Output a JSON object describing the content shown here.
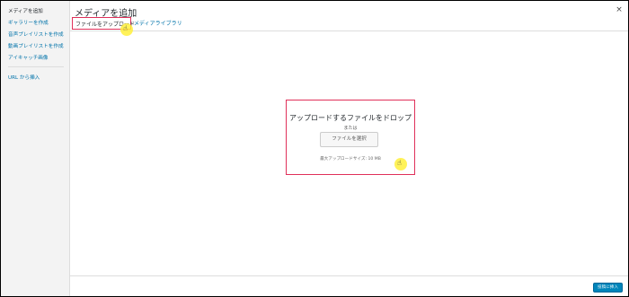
{
  "sidebar": {
    "items": [
      {
        "label": "メディアを追加"
      },
      {
        "label": "ギャラリーを作成"
      },
      {
        "label": "音声プレイリストを作成"
      },
      {
        "label": "動画プレイリストを作成"
      },
      {
        "label": "アイキャッチ画像"
      },
      {
        "label": "URL から挿入"
      }
    ]
  },
  "header": {
    "title": "メディアを追加",
    "close_symbol": "×"
  },
  "tabs": [
    {
      "label": "ファイルをアップロード"
    },
    {
      "label": "メディアライブラリ"
    }
  ],
  "uploader": {
    "drop_text": "アップロードするファイルをドロップ",
    "or_text": "または",
    "select_button": "ファイルを選択",
    "max_size": "最大アップロードサイズ: 10 MB"
  },
  "footer": {
    "insert_button": "投稿に挿入"
  },
  "icons": {
    "cursor": "hand-pointer-icon",
    "close": "close-icon"
  },
  "colors": {
    "link": "#0073aa",
    "highlight_border": "#e0305a",
    "primary_button": "#0085ba",
    "cursor_highlight": "#fff03c"
  }
}
